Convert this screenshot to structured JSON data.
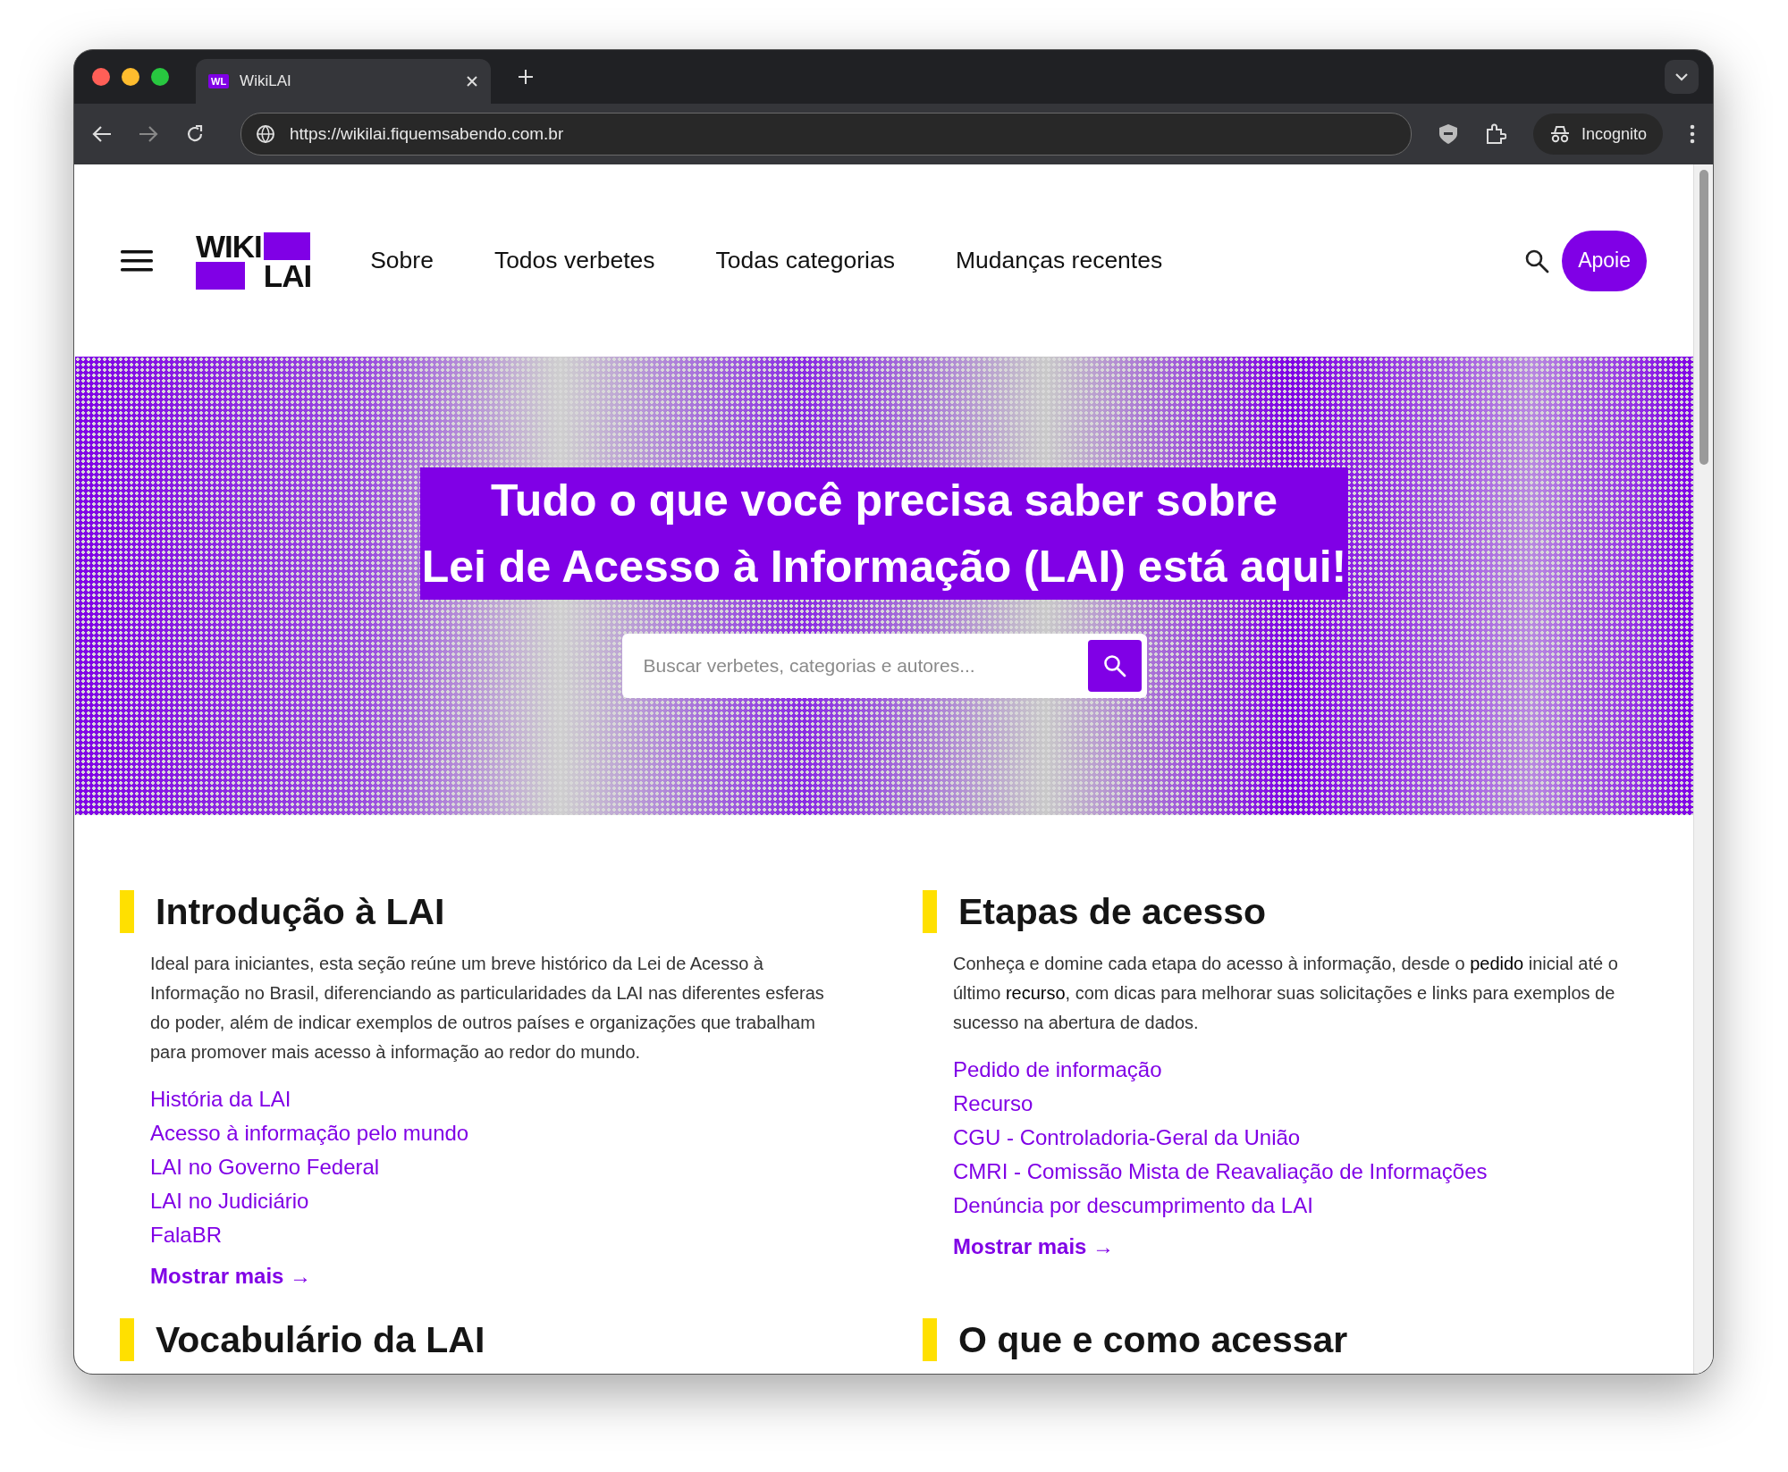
{
  "browser": {
    "tab_favicon": "WL",
    "tab_title": "WikiLAI",
    "url": "https://wikilai.fiquemsabendo.com.br",
    "profile": "Incognito"
  },
  "header": {
    "logo": [
      "WIKI",
      "LAI"
    ],
    "nav": [
      "Sobre",
      "Todos verbetes",
      "Todas categorias",
      "Mudanças recentes"
    ],
    "donate_button": "Apoie"
  },
  "hero": {
    "headline": [
      "Tudo o que você precisa saber sobre",
      "Lei de Acesso à Informação (LAI) está aqui!"
    ],
    "search": {
      "placeholder": "Buscar verbetes, categorias e autores..."
    }
  },
  "sections": [
    {
      "title": "Introdução à LAI",
      "description": [
        {
          "text": "Ideal para iniciantes, esta seção reúne um breve histórico da Lei de Acesso à Informação no Brasil, diferenciando as particularidades da LAI nas diferentes esferas do poder, além de indicar exemplos de outros países e organizações que trabalham para promover mais acesso à informação ao redor do mundo.",
          "emphasis": false
        }
      ],
      "links": [
        "História da LAI",
        "Acesso à informação pelo mundo",
        "LAI no Governo Federal",
        "LAI no Judiciário",
        "FalaBR"
      ],
      "more": "Mostrar mais →"
    },
    {
      "title": "Etapas de acesso",
      "description": [
        {
          "text": "Conheça e domine cada etapa do acesso à informação, desde o ",
          "emphasis": false
        },
        {
          "text": "pedido",
          "emphasis": true
        },
        {
          "text": " inicial até o último ",
          "emphasis": false
        },
        {
          "text": "recurso",
          "emphasis": true
        },
        {
          "text": ", com dicas para melhorar suas solicitações e links para exemplos de sucesso na abertura de dados.",
          "emphasis": false
        }
      ],
      "links": [
        "Pedido de informação",
        "Recurso",
        "CGU - Controladoria-Geral da União",
        "CMRI - Comissão Mista de Reavaliação de Informações",
        "Denúncia por descumprimento da LAI"
      ],
      "more": "Mostrar mais →"
    },
    {
      "title": "Vocabulário da LAI"
    },
    {
      "title": "O que e como acessar"
    }
  ]
}
